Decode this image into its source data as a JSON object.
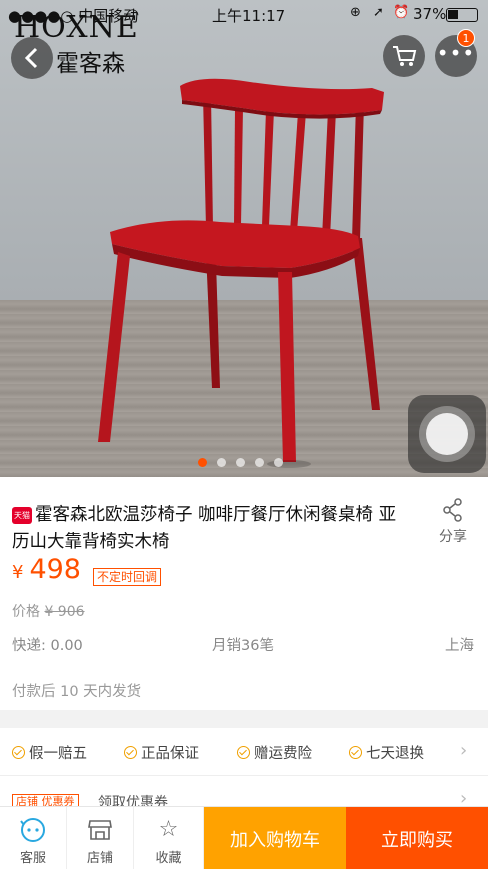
{
  "status": {
    "carrier": "●●●●○ 中国移动",
    "time": "上午11:17",
    "battery": "37%",
    "icons": [
      "wifi-icon",
      "lock-rotation-icon",
      "location-icon",
      "alarm-icon",
      "battery-icon"
    ]
  },
  "brand": {
    "en": "HOXNE",
    "cn": "霍客森"
  },
  "header": {
    "cart_badge": "1"
  },
  "product": {
    "tmall_badge": "天猫",
    "title": "霍客森北欧温莎椅子 咖啡厅餐厅休闲餐桌椅 亚历山大靠背椅实木椅",
    "share_label": "分享",
    "currency": "¥",
    "price": "498",
    "price_tag": "不定时回调",
    "orig_label": "价格",
    "orig_price": "¥ 906",
    "shipping_fee": "快递: 0.00",
    "monthly_sales": "月销36笔",
    "location": "上海",
    "delivery": "付款后 10 天内发货"
  },
  "carousel": {
    "count": 5,
    "active": 0
  },
  "services": [
    "假一赔五",
    "正品保证",
    "赠运费险",
    "七天退换"
  ],
  "coupon": {
    "tag": "店铺 优惠券",
    "text": "领取优惠券"
  },
  "bottom": {
    "tabs": [
      {
        "label": "客服",
        "icon": "customer-service-icon"
      },
      {
        "label": "店铺",
        "icon": "shop-icon"
      },
      {
        "label": "收藏",
        "icon": "star-icon"
      }
    ],
    "add_to_cart": "加入购物车",
    "buy_now": "立即购买"
  },
  "colors": {
    "accent": "#ff5000",
    "cart": "#ffa200",
    "chair": "#b5141c"
  }
}
